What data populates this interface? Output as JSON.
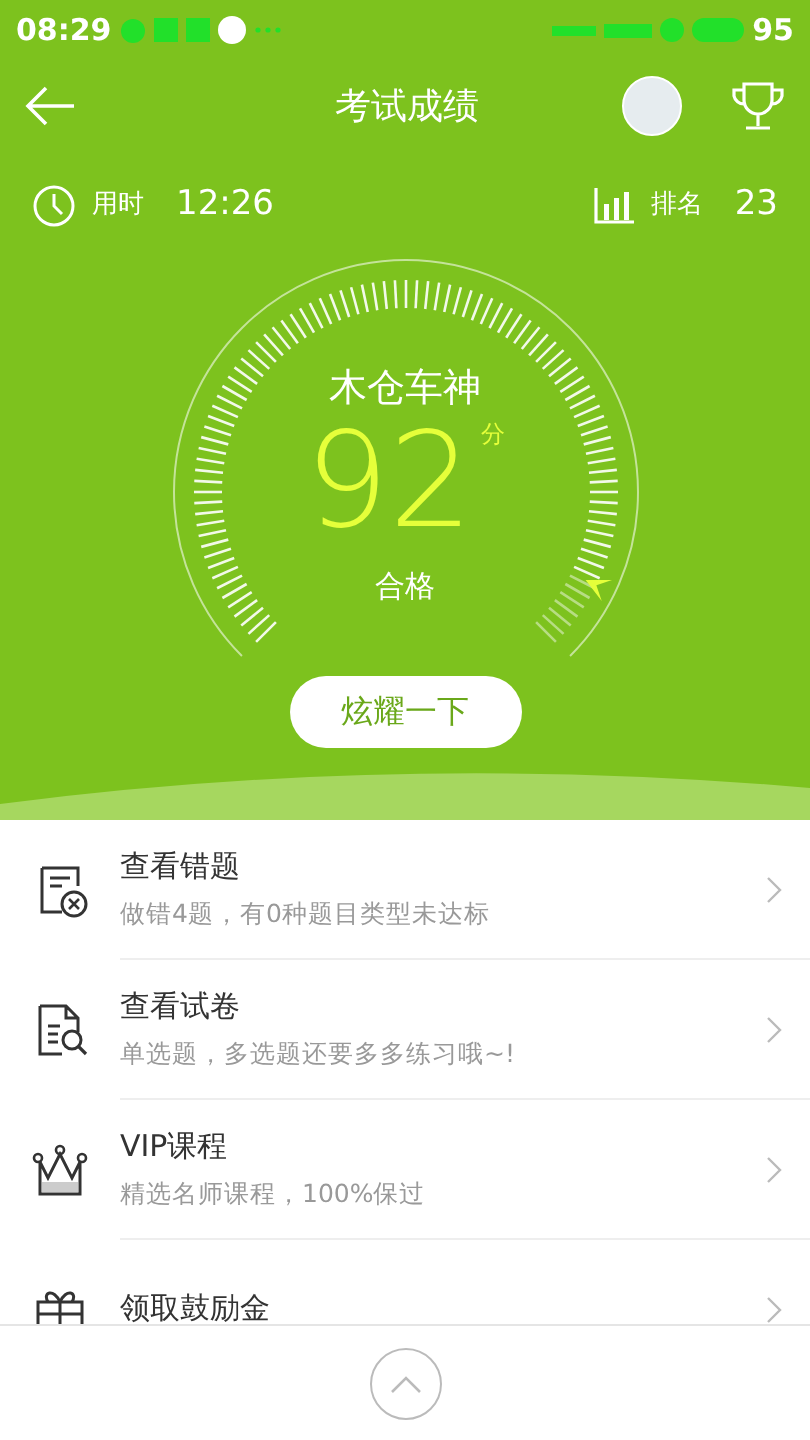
{
  "status_bar": {
    "time": "08:29",
    "battery": "95"
  },
  "header": {
    "title": "考试成绩"
  },
  "stats": {
    "time_label": "用时",
    "time_value": "12:26",
    "rank_label": "排名",
    "rank_value": "23"
  },
  "gauge": {
    "title": "木仓车神",
    "score": "92",
    "unit": "分",
    "result": "合格",
    "level": 0.93
  },
  "share_button": "炫耀一下",
  "menu": [
    {
      "kind": "wrong",
      "title": "查看错题",
      "subtitle": "做错4题，有0种题目类型未达标"
    },
    {
      "kind": "paper",
      "title": "查看试卷",
      "subtitle": "单选题，多选题还要多多练习哦~!"
    },
    {
      "kind": "crown",
      "title": "VIP课程",
      "subtitle": "精选名师课程，100%保过"
    },
    {
      "kind": "gift",
      "title": "领取鼓励金"
    }
  ]
}
